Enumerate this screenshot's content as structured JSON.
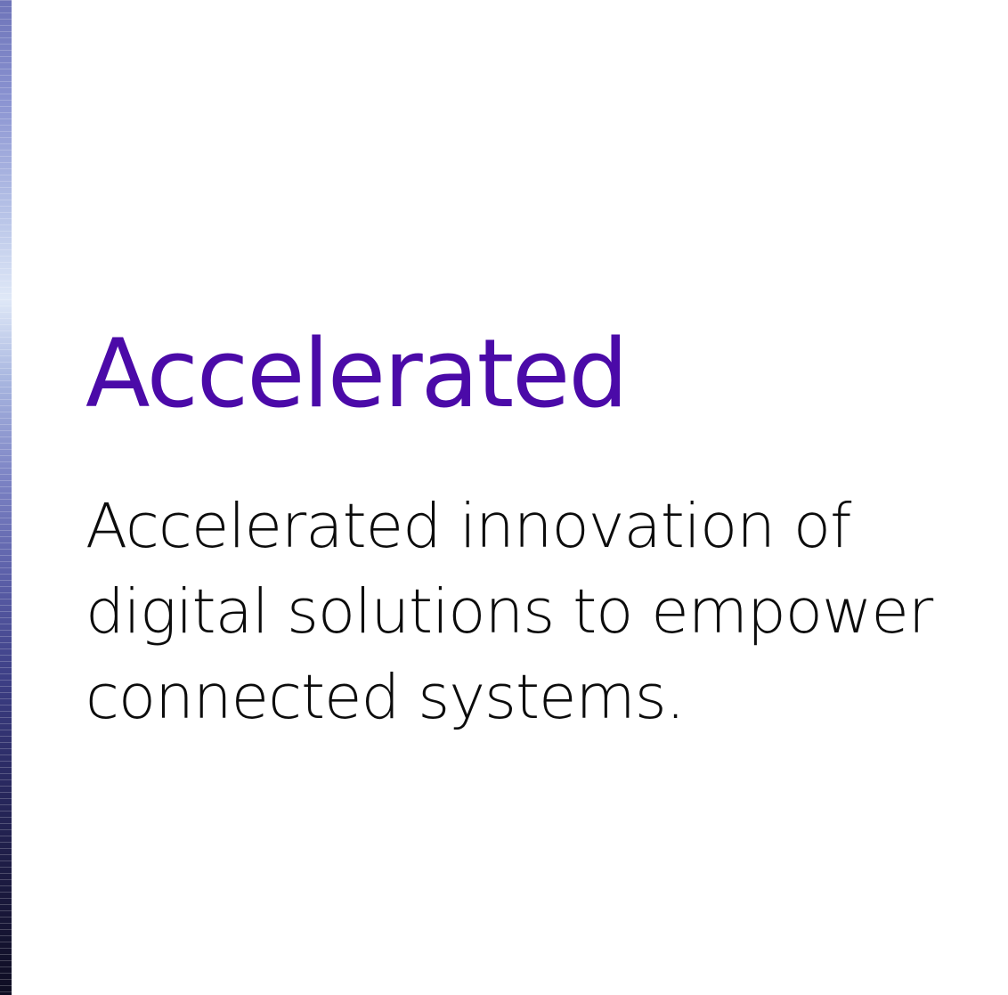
{
  "hero": {
    "title": "Accelerated",
    "description": "Accelerated innovation of digital solutions to empower connected systems."
  },
  "colors": {
    "title": "#4b0aa8",
    "body": "#0c0c0c",
    "background": "#ffffff"
  }
}
